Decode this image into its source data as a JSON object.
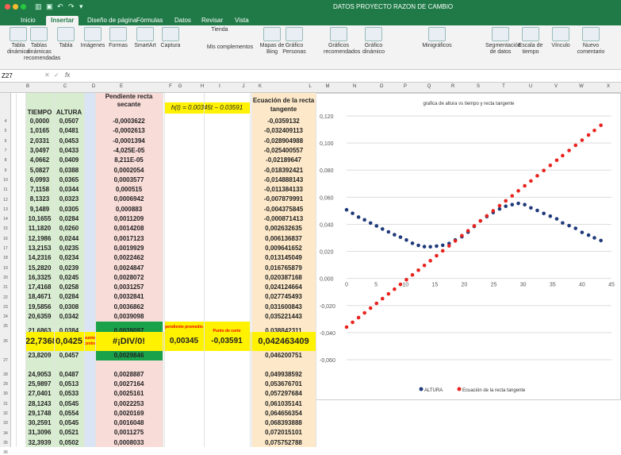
{
  "window": {
    "title": "DATOS PROYECTO RAZON DE CAMBIO"
  },
  "tabs": [
    "Inicio",
    "Insertar",
    "Diseño de página",
    "Fórmulas",
    "Datos",
    "Revisar",
    "Vista"
  ],
  "active_tab": "Insertar",
  "ribbon": [
    {
      "label": "Tabla dinámica",
      "icon": "pivot-table-icon"
    },
    {
      "label": "Tablas dinámicas recomendadas",
      "icon": "recommended-pivot-icon"
    },
    {
      "label": "Tabla",
      "icon": "table-icon"
    },
    {
      "label": "Imágenes",
      "icon": "images-icon"
    },
    {
      "label": "Formas",
      "icon": "shapes-icon"
    },
    {
      "label": "SmartArt",
      "icon": "smartart-icon"
    },
    {
      "label": "Captura",
      "icon": "screenshot-icon"
    },
    {
      "label": "Tienda",
      "icon": "store-icon"
    },
    {
      "label": "Mis complementos",
      "icon": "addins-icon"
    },
    {
      "label": "Mapas de Bing",
      "icon": "bing-maps-icon"
    },
    {
      "label": "Gráfico Personas",
      "icon": "people-graph-icon"
    },
    {
      "label": "Gráficos recomendados",
      "icon": "recommended-charts-icon"
    },
    {
      "label": "Gráfico dinámico",
      "icon": "pivot-chart-icon"
    },
    {
      "label": "Minigráficos",
      "icon": "sparklines-icon"
    },
    {
      "label": "Segmentación de datos",
      "icon": "slicer-icon"
    },
    {
      "label": "Escala de tiempo",
      "icon": "timeline-icon"
    },
    {
      "label": "Vínculo",
      "icon": "link-icon"
    },
    {
      "label": "Nuevo comentario",
      "icon": "comment-icon"
    }
  ],
  "formula_bar": {
    "cell_ref": "Z27",
    "fx": "fx"
  },
  "columns": [
    "B",
    "C",
    "D",
    "E",
    "F",
    "G",
    "H",
    "I",
    "J",
    "K",
    "L",
    "M",
    "N",
    "O",
    "P",
    "Q",
    "R",
    "S",
    "T",
    "U",
    "V",
    "W",
    "X"
  ],
  "headers": {
    "tiempo": "TIEMPO",
    "altura": "ALTURA",
    "pendiente": "Pendiente recta secante",
    "ecuacion": "Ecuación de la recta tangente",
    "formula": "h(t) = 0.00345t − 0.03591"
  },
  "row_numbers": [
    "4",
    "5",
    "6",
    "7",
    "8",
    "9",
    "10",
    "11",
    "12",
    "13",
    "14",
    "15",
    "16",
    "17",
    "18",
    "19",
    "20",
    "21",
    "22",
    "23",
    "24",
    "25",
    "26",
    "27",
    "28",
    "29",
    "30",
    "31",
    "32",
    "33",
    "34",
    "35",
    "36"
  ],
  "rows": [
    [
      "0,0000",
      "0,0507",
      "-0,0003622",
      "-0,0359132"
    ],
    [
      "1,0165",
      "0,0481",
      "-0,0002613",
      "-0,032409113"
    ],
    [
      "2,0331",
      "0,0453",
      "-0,0001394",
      "-0,028904988"
    ],
    [
      "3,0497",
      "0,0433",
      "-4,025E-05",
      "-0,025400557"
    ],
    [
      "4,0662",
      "0,0409",
      "8,211E-05",
      "-0,02189647"
    ],
    [
      "5,0827",
      "0,0388",
      "0,0002054",
      "-0,018392421"
    ],
    [
      "6,0993",
      "0,0365",
      "0,0003577",
      "-0,014888143"
    ],
    [
      "7,1158",
      "0,0344",
      "0,000515",
      "-0,011384133"
    ],
    [
      "8,1323",
      "0,0323",
      "0,0006942",
      "-0,007879991"
    ],
    [
      "9,1489",
      "0,0305",
      "0,000883",
      "-0,004375845"
    ],
    [
      "10,1655",
      "0,0284",
      "0,0011209",
      "-0,000871413"
    ],
    [
      "11,1820",
      "0,0260",
      "0,0014208",
      "0,002632635"
    ],
    [
      "12,1986",
      "0,0244",
      "0,0017123",
      "0,006136837"
    ],
    [
      "13,2153",
      "0,0235",
      "0,0019929",
      "0,009641652"
    ],
    [
      "14,2316",
      "0,0234",
      "0,0022462",
      "0,013145049"
    ],
    [
      "15,2820",
      "0,0239",
      "0,0024847",
      "0,016765879"
    ],
    [
      "16,3325",
      "0,0245",
      "0,0028072",
      "0,020387168"
    ],
    [
      "17,4168",
      "0,0258",
      "0,0031257",
      "0,024124664"
    ],
    [
      "18,4671",
      "0,0284",
      "0,0032841",
      "0,027745493"
    ],
    [
      "19,5856",
      "0,0308",
      "0,0036862",
      "0,031600843"
    ],
    [
      "20,6359",
      "0,0342",
      "0,0039098",
      "0,035221443"
    ],
    [
      "21,6863",
      "0,0384",
      "0,0039097",
      "0,038842311"
    ],
    [
      "22,7368",
      "0,0425",
      "#¡DIV/0!",
      "0,042463409"
    ],
    [
      "23,8209",
      "0,0457",
      "0,0029846",
      "0,046200751"
    ],
    [
      "24,9053",
      "0,0487",
      "0,0028887",
      "0,049938592"
    ],
    [
      "25,9897",
      "0,0513",
      "0,0027164",
      "0,053676701"
    ],
    [
      "27,0401",
      "0,0533",
      "0,0025161",
      "0,057297684"
    ],
    [
      "28,1243",
      "0,0545",
      "0,0022253",
      "0,061035141"
    ],
    [
      "29,1748",
      "0,0554",
      "0,0020169",
      "0,064656354"
    ],
    [
      "30,2591",
      "0,0545",
      "0,0016048",
      "0,068393888"
    ],
    [
      "31,3096",
      "0,0521",
      "0,0011275",
      "0,072015101"
    ],
    [
      "32,3939",
      "0,0502",
      "0,0008033",
      "0,075752788"
    ]
  ],
  "labels": {
    "punto_central": "punto central",
    "pendiente_promedio": "pendiente promedio",
    "punto_corte": "Punto de corte",
    "pend_val": "0,00345",
    "corte_val": "-0,03591"
  },
  "colors": {
    "green_header": "#d8ecd0",
    "blue_col": "#d9e5f5",
    "pink_col": "#f8dcd8",
    "yellow": "#fff200",
    "orange_col": "#fde9c9",
    "green_cell": "#1aa24b",
    "excel_green": "#1f7a47"
  },
  "chart_data": {
    "type": "scatter",
    "title": "grafica de altura vs tiempo y recta tangente",
    "xlim": [
      0,
      45
    ],
    "ylim": [
      -0.06,
      0.12
    ],
    "xticks": [
      "0",
      "5",
      "10",
      "15",
      "20",
      "25",
      "30",
      "35",
      "40",
      "45"
    ],
    "yticks": [
      "-0,060",
      "-0,040",
      "-0,020",
      "0,000",
      "0,020",
      "0,040",
      "0,060",
      "0,080",
      "0,100",
      "0,120"
    ],
    "grid": true,
    "legend": "bottom",
    "series": [
      {
        "name": "ALTURA",
        "color": "#1f3a7a",
        "x": [
          0,
          1.0165,
          2.0331,
          3.0497,
          4.0662,
          5.0827,
          6.0993,
          7.1158,
          8.1323,
          9.1489,
          10.1655,
          11.182,
          12.1986,
          13.2153,
          14.2316,
          15.282,
          16.3325,
          17.4168,
          18.4671,
          19.5856,
          20.6359,
          21.6863,
          22.7368,
          23.8209,
          24.9053,
          25.9897,
          27.0401,
          28.1243,
          29.1748,
          30.2591,
          31.3096,
          32.3939,
          33.5,
          34.6,
          35.7,
          36.7,
          37.8,
          38.9,
          40,
          41.1,
          42.1,
          43.2
        ],
        "y": [
          0.0507,
          0.0481,
          0.0453,
          0.0433,
          0.0409,
          0.0388,
          0.0365,
          0.0344,
          0.0323,
          0.0305,
          0.0284,
          0.026,
          0.0244,
          0.0235,
          0.0234,
          0.0239,
          0.0245,
          0.0258,
          0.0284,
          0.0308,
          0.0342,
          0.0384,
          0.0425,
          0.0457,
          0.0487,
          0.0513,
          0.0533,
          0.0545,
          0.0554,
          0.0545,
          0.0521,
          0.0502,
          0.048,
          0.046,
          0.044,
          0.041,
          0.039,
          0.037,
          0.034,
          0.032,
          0.03,
          0.028
        ]
      },
      {
        "name": "Ecuación de la recta tangente",
        "color": "#e8231e",
        "x": [
          0,
          1.0165,
          2.0331,
          3.0497,
          4.0662,
          5.0827,
          6.0993,
          7.1158,
          8.1323,
          9.1489,
          10.1655,
          11.182,
          12.1986,
          13.2153,
          14.2316,
          15.282,
          16.3325,
          17.4168,
          18.4671,
          19.5856,
          20.6359,
          21.6863,
          22.7368,
          23.8209,
          24.9053,
          25.9897,
          27.0401,
          28.1243,
          29.1748,
          30.2591,
          31.3096,
          32.3939,
          33.5,
          34.6,
          35.7,
          36.7,
          37.8,
          38.9,
          40,
          41.1,
          42.1,
          43.2
        ],
        "y": [
          -0.0359,
          -0.0324,
          -0.0289,
          -0.0254,
          -0.0219,
          -0.0184,
          -0.0149,
          -0.0114,
          -0.0079,
          -0.0044,
          -0.0009,
          0.0026,
          0.0061,
          0.0096,
          0.0131,
          0.0168,
          0.0204,
          0.0241,
          0.0277,
          0.0316,
          0.0352,
          0.0388,
          0.0425,
          0.0462,
          0.0499,
          0.0537,
          0.0573,
          0.061,
          0.0647,
          0.0684,
          0.072,
          0.0758,
          0.0797,
          0.0835,
          0.0873,
          0.0907,
          0.0945,
          0.0983,
          0.1021,
          0.1059,
          0.1093,
          0.1131
        ]
      }
    ]
  }
}
